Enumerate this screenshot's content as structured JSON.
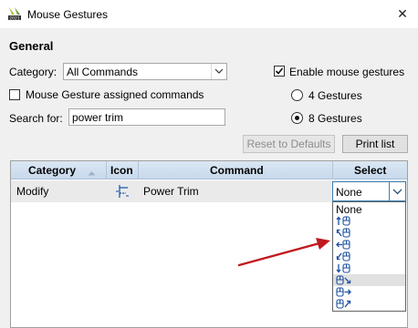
{
  "window": {
    "title": "Mouse Gestures"
  },
  "general": {
    "section_title": "General",
    "category_label": "Category:",
    "category_value": "All Commands",
    "enable_label": "Enable mouse gestures",
    "enable_checked": true,
    "assigned_label": "Mouse Gesture assigned commands",
    "assigned_checked": false,
    "search_label": "Search for:",
    "search_value": "power trim",
    "gestures_4_label": "4 Gestures",
    "gestures_8_label": "8 Gestures",
    "selected_gestures": "8",
    "reset_label": "Reset to Defaults",
    "print_label": "Print list"
  },
  "table": {
    "columns": [
      "Category",
      "Icon",
      "Command",
      "Select"
    ],
    "sorted_column": "Category",
    "rows": [
      {
        "category": "Modify",
        "icon": "power-trim-icon",
        "command": "Power Trim",
        "select": "None"
      }
    ]
  },
  "dropdown": {
    "selected": "None",
    "options": [
      {
        "label": "None",
        "icon": null
      },
      {
        "label": "",
        "icon": "gesture-up-icon"
      },
      {
        "label": "",
        "icon": "gesture-up-left-icon"
      },
      {
        "label": "",
        "icon": "gesture-left-icon"
      },
      {
        "label": "",
        "icon": "gesture-down-left-icon"
      },
      {
        "label": "",
        "icon": "gesture-down-icon"
      },
      {
        "label": "",
        "icon": "gesture-down-right-icon",
        "highlighted": true
      },
      {
        "label": "",
        "icon": "gesture-right-icon"
      },
      {
        "label": "",
        "icon": "gesture-up-right-icon"
      }
    ]
  },
  "colors": {
    "accent": "#2b67b0",
    "annotation_arrow": "#c0181f",
    "header_bg": "#d1e0f0"
  }
}
